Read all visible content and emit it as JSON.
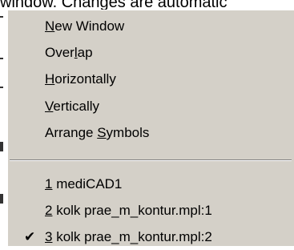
{
  "background": {
    "partial_text": "window. Changes are automatic"
  },
  "menu": {
    "items": [
      {
        "pre": "",
        "key": "N",
        "post": "ew Window"
      },
      {
        "pre": "Over",
        "key": "l",
        "post": "ap"
      },
      {
        "pre": "",
        "key": "H",
        "post": "orizontally"
      },
      {
        "pre": "",
        "key": "V",
        "post": "ertically"
      },
      {
        "pre": "Arrange ",
        "key": "S",
        "post": "ymbols"
      }
    ],
    "windows": [
      {
        "key": "1",
        "post": " mediCAD1",
        "checked": false
      },
      {
        "key": "2",
        "post": " kolk prae_m_kontur.mpl:1",
        "checked": false
      },
      {
        "key": "3",
        "post": " kolk prae_m_kontur.mpl:2",
        "checked": true,
        "check_glyph": "✔"
      }
    ]
  }
}
